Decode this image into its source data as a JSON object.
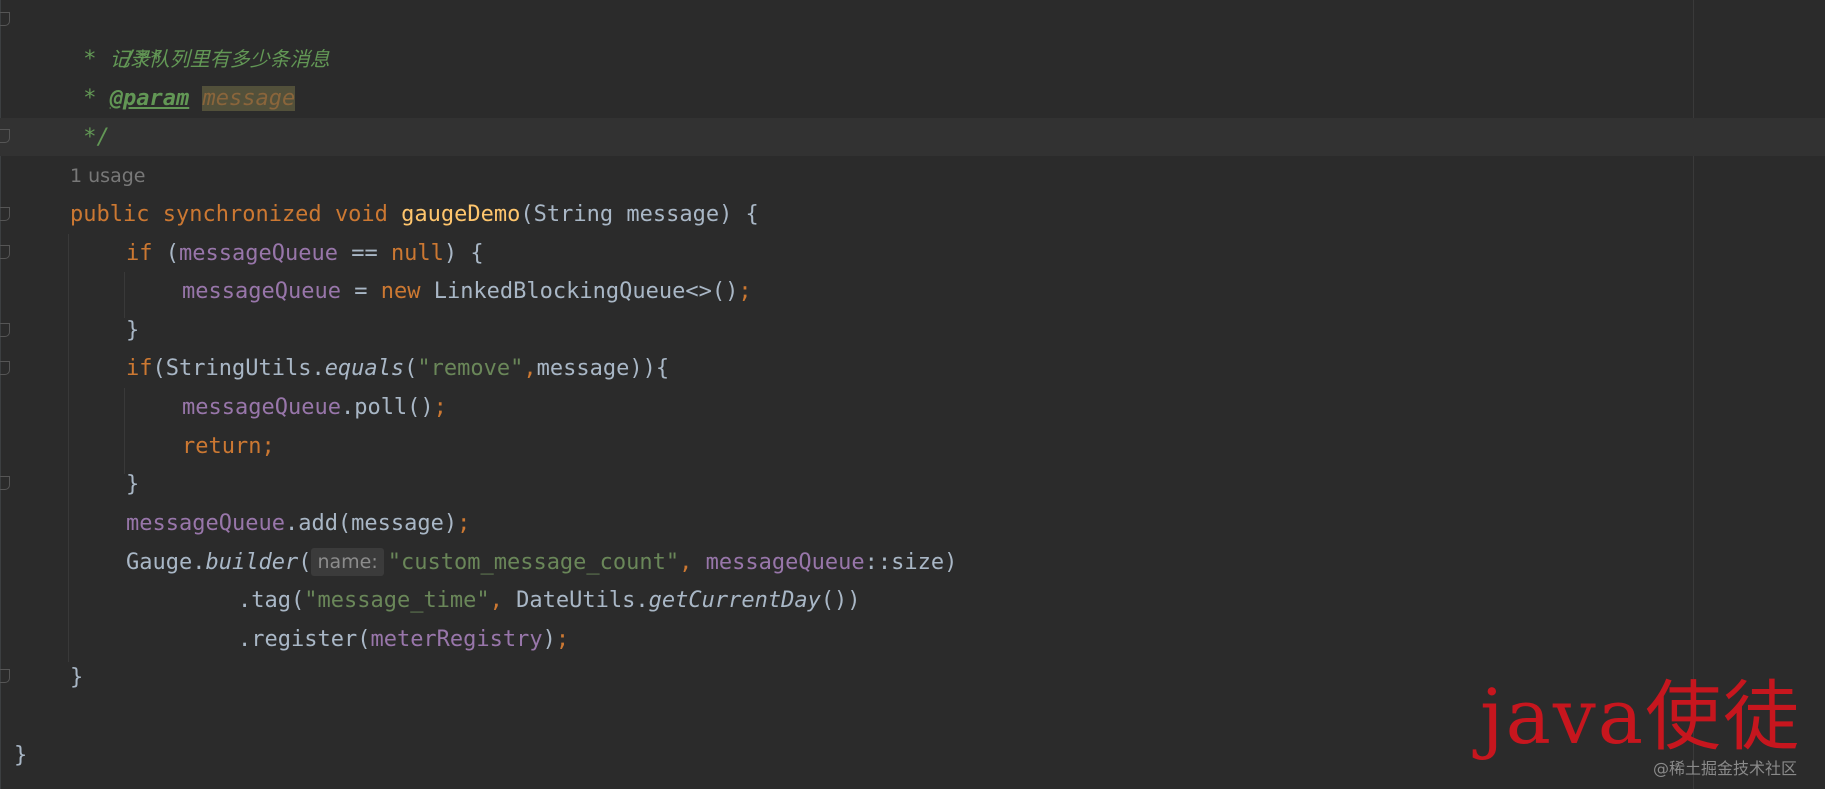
{
  "code": {
    "doc_open": "/**",
    "doc_desc_star": " * ",
    "doc_desc": "记录队列里有多少条消息",
    "doc_param_star": " * ",
    "doc_param_tag": "@param",
    "doc_param_name": "message",
    "doc_close": " */",
    "usage_hint": "1 usage",
    "sig_public": "public",
    "sig_synchronized": "synchronized",
    "sig_void": "void",
    "sig_method": "gaugeDemo",
    "sig_params": "(String message) {",
    "if1_kw": "if",
    "if1_open": " (",
    "if1_field": "messageQueue",
    "if1_eq": " == ",
    "if1_null": "null",
    "if1_close": ") {",
    "assign_field": "messageQueue",
    "assign_eq": " = ",
    "assign_new": "new",
    "assign_type": " LinkedBlockingQueue<>()",
    "semicolon": ";",
    "brace_close": "}",
    "if2_kw": "if",
    "if2_a": "(StringUtils.",
    "if2_method": "equals",
    "if2_b": "(",
    "if2_str": "\"remove\"",
    "if2_comma": ",",
    "if2_c": "message)){",
    "poll_field": "messageQueue",
    "poll_call": ".poll()",
    "return_kw": "return",
    "add_field": "messageQueue",
    "add_call": ".add(message)",
    "gauge_a": "Gauge.",
    "gauge_method": "builder",
    "gauge_b": "(",
    "gauge_hint": "name:",
    "gauge_str": "\"custom_message_count\"",
    "gauge_comma": ",",
    "gauge_field": "messageQueue",
    "gauge_c": "::size)",
    "tag_a": ".tag(",
    "tag_str": "\"message_time\"",
    "tag_comma": ",",
    "tag_b": " DateUtils.",
    "tag_method": "getCurrentDay",
    "tag_c": "())",
    "reg_a": ".register(",
    "reg_field": "meterRegistry",
    "reg_b": ")"
  },
  "watermark": {
    "text": "java使徒",
    "site": "@稀土掘金技术社区"
  },
  "colors": {
    "background": "#2b2b2b",
    "keyword": "#cc7832",
    "method_decl": "#ffc66d",
    "field": "#9876aa",
    "string": "#6a8759",
    "doc_comment": "#629755",
    "plain": "#a9b7c6",
    "watermark": "#c7161e"
  }
}
